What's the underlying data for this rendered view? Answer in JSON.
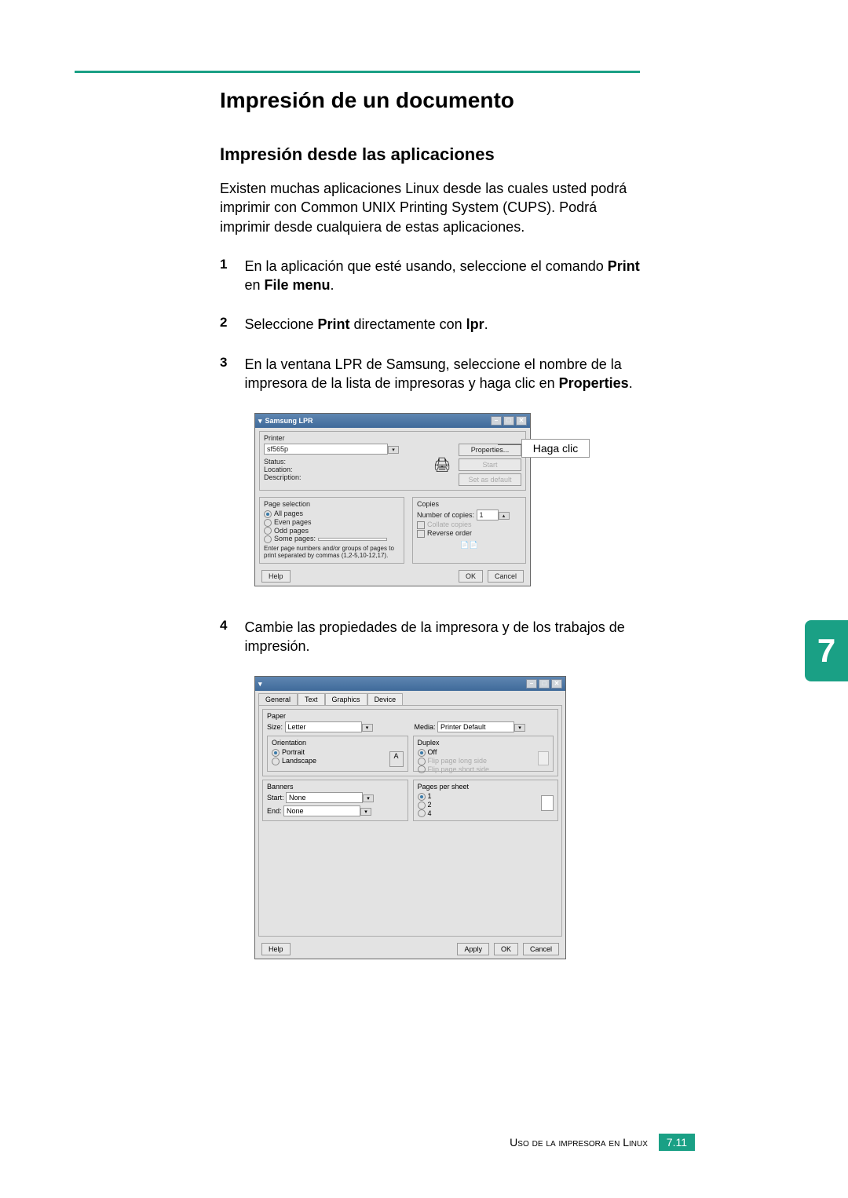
{
  "heading": "Impresión de un documento",
  "subheading": "Impresión desde las aplicaciones",
  "intro": "Existen muchas aplicaciones Linux desde las cuales usted podrá imprimir con Common UNIX Printing System (CUPS). Podrá imprimir desde cualquiera de estas aplicaciones.",
  "steps": {
    "s1_pre": "En la aplicación que esté usando, seleccione el comando ",
    "s1_b1": "Print",
    "s1_mid": " en ",
    "s1_b2": "File menu",
    "s1_end": ".",
    "s2_pre": "Seleccione ",
    "s2_b1": "Print",
    "s2_mid": " directamente con ",
    "s2_b2": "lpr",
    "s2_end": ".",
    "s3_pre": "En la ventana LPR de Samsung, seleccione el nombre de la impresora de la lista de impresoras y haga clic en ",
    "s3_b1": "Properties",
    "s3_end": ".",
    "s4": "Cambie las propiedades de la impresora y de los trabajos de impresión."
  },
  "callout": "Haga clic",
  "win1": {
    "title": "Samsung LPR",
    "printer_group": "Printer",
    "printer_value": "sf565p",
    "properties_btn": "Properties...",
    "start_btn": "Start",
    "setdefault_btn": "Set as default",
    "status": "Status:",
    "location": "Location:",
    "description": "Description:",
    "pagesel_group": "Page selection",
    "all": "All pages",
    "even": "Even pages",
    "odd": "Odd pages",
    "some": "Some pages:",
    "some_hint": "Enter page numbers and/or groups of pages to print separated by commas (1,2-5,10-12,17).",
    "copies_group": "Copies",
    "numcopies": "Number of copies:",
    "numcopies_val": "1",
    "collate": "Collate copies",
    "reverse": "Reverse order",
    "help": "Help",
    "ok": "OK",
    "cancel": "Cancel"
  },
  "win2": {
    "tabs": [
      "General",
      "Text",
      "Graphics",
      "Device"
    ],
    "paper_group": "Paper",
    "size": "Size:",
    "size_val": "Letter",
    "media": "Media:",
    "media_val": "Printer Default",
    "orient_group": "Orientation",
    "portrait": "Portrait",
    "landscape": "Landscape",
    "duplex_group": "Duplex",
    "duplex_off": "Off",
    "duplex_long": "Flip page long side",
    "duplex_short": "Flip page short side",
    "banners_group": "Banners",
    "start": "Start:",
    "end": "End:",
    "none": "None",
    "pps_group": "Pages per sheet",
    "pps1": "1",
    "pps2": "2",
    "pps4": "4",
    "help": "Help",
    "apply": "Apply",
    "ok": "OK",
    "cancel": "Cancel"
  },
  "sidetab": "7",
  "footer": {
    "text": "Uso de la impresora en Linux",
    "page": "7.11"
  }
}
